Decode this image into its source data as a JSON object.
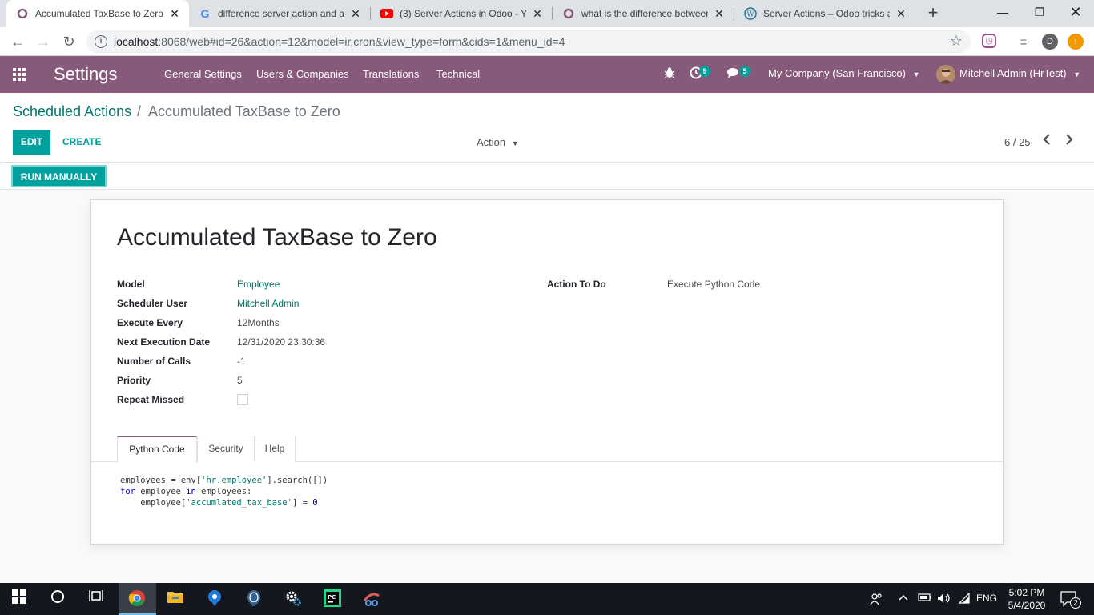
{
  "browser": {
    "tabs": [
      {
        "title": "Accumulated TaxBase to Zero",
        "favicon": "odoo-icon",
        "active": true
      },
      {
        "title": "difference server action and au",
        "favicon": "google-icon",
        "active": false
      },
      {
        "title": "(3) Server Actions in Odoo - Yo",
        "favicon": "youtube-icon",
        "active": false
      },
      {
        "title": "what is the difference between",
        "favicon": "odoo-icon",
        "active": false
      },
      {
        "title": "Server Actions – Odoo tricks an",
        "favicon": "wordpress-icon",
        "active": false
      }
    ],
    "url_host": "localhost",
    "url_rest": ":8068/web#id=26&action=12&model=ir.cron&view_type=form&cids=1&menu_id=4",
    "profile_initial": "D"
  },
  "odoo": {
    "app_name": "Settings",
    "menu": [
      "General Settings",
      "Users & Companies",
      "Translations",
      "Technical"
    ],
    "activity_count": "9",
    "message_count": "5",
    "company": "My Company (San Francisco)",
    "user": "Mitchell Admin (HrTest)"
  },
  "control_panel": {
    "breadcrumb_parent": "Scheduled Actions",
    "breadcrumb_separator": "/",
    "breadcrumb_current": "Accumulated TaxBase to Zero",
    "edit_label": "EDIT",
    "create_label": "CREATE",
    "action_label": "Action",
    "pager": "6 / 25",
    "run_manually_label": "RUN MANUALLY"
  },
  "record": {
    "title": "Accumulated TaxBase to Zero",
    "fields": {
      "model_label": "Model",
      "model_value": "Employee",
      "user_label": "Scheduler User",
      "user_value": "Mitchell Admin",
      "interval_label": "Execute Every",
      "interval_value": "12Months",
      "nextcall_label": "Next Execution Date",
      "nextcall_value": "12/31/2020 23:30:36",
      "numbercall_label": "Number of Calls",
      "numbercall_value": "-1",
      "priority_label": "Priority",
      "priority_value": "5",
      "doall_label": "Repeat Missed",
      "doall_checked": false,
      "state_label": "Action To Do",
      "state_value": "Execute Python Code"
    },
    "notebook_tabs": [
      "Python Code",
      "Security",
      "Help"
    ],
    "code_line1_a": "employees = env[",
    "code_line1_b": "'hr.employee'",
    "code_line1_c": "].search([])",
    "code_line2_kw1": "for",
    "code_line2_a": " employee ",
    "code_line2_kw2": "in",
    "code_line2_b": " employees:",
    "code_line3_a": "    employee[",
    "code_line3_b": "'accumlated_tax_base'",
    "code_line3_c": "] = ",
    "code_line3_d": "0"
  },
  "taskbar": {
    "language": "ENG",
    "time": "5:02 PM",
    "date": "5/4/2020",
    "notification_count": "2"
  },
  "colors": {
    "odoo_purple": "#875a7b",
    "odoo_teal": "#00a09d",
    "link": "#00756a"
  }
}
